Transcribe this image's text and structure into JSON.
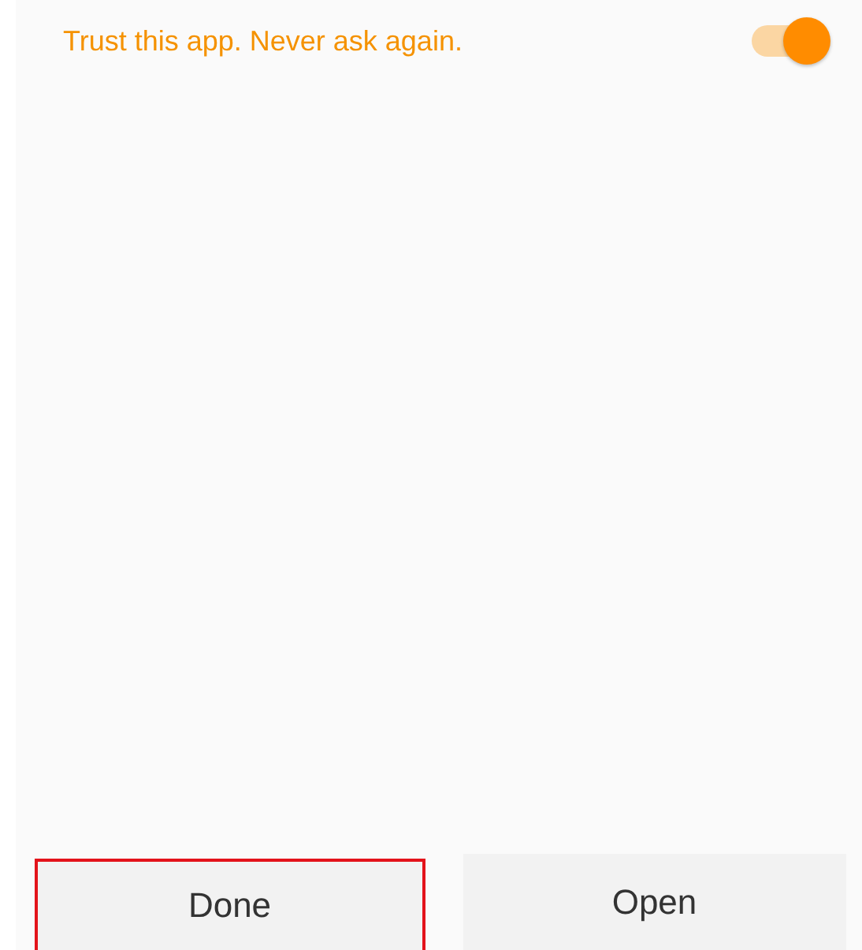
{
  "trust_setting": {
    "label": "Trust this app. Never ask again.",
    "on": true
  },
  "buttons": [
    {
      "label": "Done",
      "highlighted": true
    },
    {
      "label": "Open",
      "highlighted": false
    }
  ]
}
